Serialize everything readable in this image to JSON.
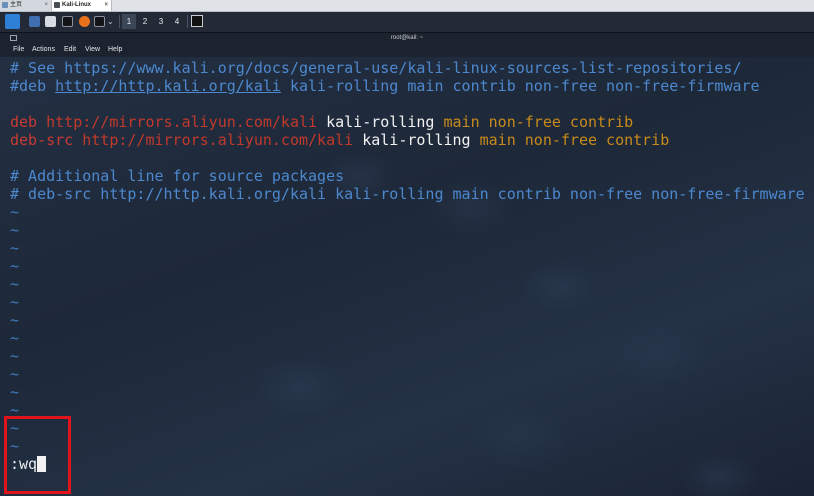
{
  "vmware": {
    "tabs": [
      {
        "label": "主页"
      },
      {
        "label": "Kali-Linux"
      }
    ]
  },
  "panel": {
    "workspaces": [
      "1",
      "2",
      "3",
      "4"
    ]
  },
  "window": {
    "title": "root@kali: ~",
    "menu": [
      "File",
      "Actions",
      "Edit",
      "View",
      "Help"
    ]
  },
  "editor": {
    "line1": "# See https://www.kali.org/docs/general-use/kali-linux-sources-list-repositories/",
    "line2_hash": "#deb ",
    "line2_url": "http://http.kali.org/kali",
    "line2_rest": " kali-rolling main contrib non-free non-free-firmware",
    "line4_kw": "deb ",
    "line4_url": "http://mirrors.aliyun.com/kali",
    "line4_dist": " kali-rolling ",
    "line4_comp": "main non-free contrib",
    "line5_kw": "deb-src ",
    "line5_url": "http://mirrors.aliyun.com/kali",
    "line5_dist": " kali-rolling ",
    "line5_comp": "main non-free contrib",
    "line7": "# Additional line for source packages",
    "line8": "# deb-src http://http.kali.org/kali kali-rolling main contrib non-free non-free-firmware",
    "tilde": "~",
    "command": ":wq"
  },
  "colors": {
    "comment": "#4d88ce",
    "url": "#c1392b",
    "components": "#c88a1b",
    "highlight_box": "#e0141b"
  }
}
